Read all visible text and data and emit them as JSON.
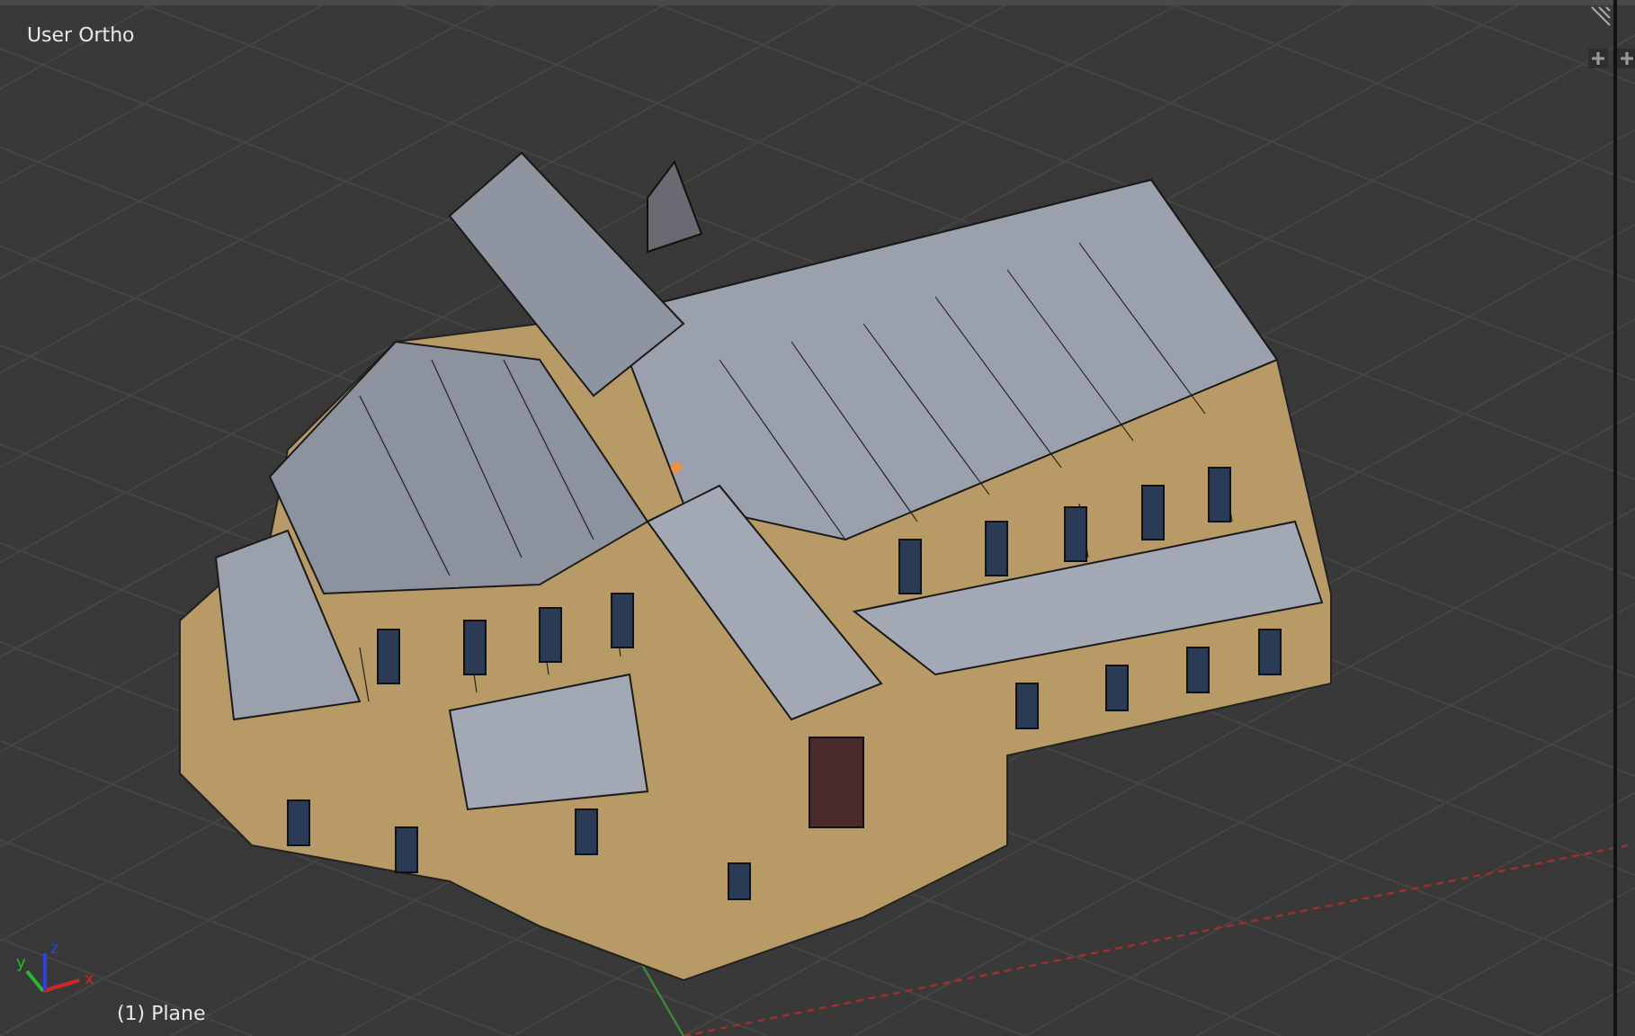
{
  "viewport": {
    "view_label": "User Ortho",
    "object_label": "(1) Plane",
    "axes": [
      {
        "label": "x",
        "color": "#d02828"
      },
      {
        "label": "y",
        "color": "#28b828"
      },
      {
        "label": "z",
        "color": "#3040e0"
      }
    ]
  }
}
